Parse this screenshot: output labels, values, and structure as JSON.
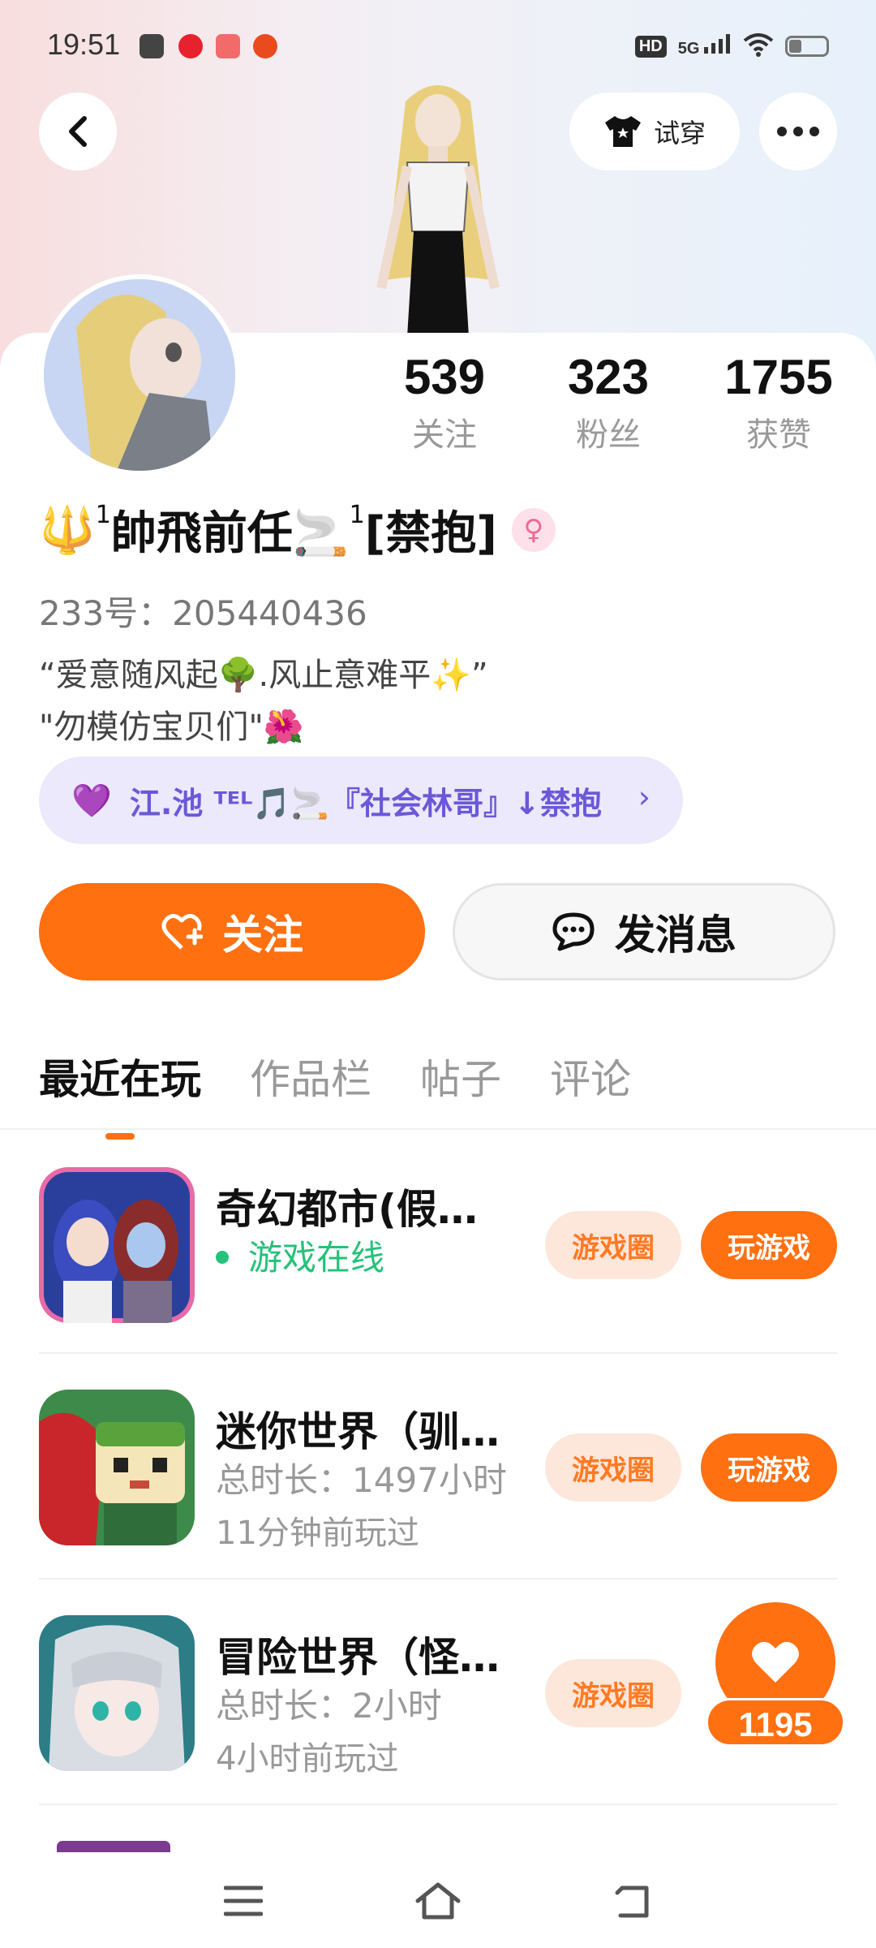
{
  "status_bar": {
    "time": "19:51",
    "hd": "HD",
    "network": "5G",
    "battery_level": 0.35
  },
  "header": {
    "try_on_label": "试穿"
  },
  "stats": [
    {
      "value": "539",
      "label": "关注"
    },
    {
      "value": "323",
      "label": "粉丝"
    },
    {
      "value": "1755",
      "label": "获赞"
    }
  ],
  "profile": {
    "name_prefix": "🔱",
    "sup1": "1",
    "name_main": "帥飛前任🚬",
    "sup2": "1",
    "name_suffix": "[禁抱]",
    "gender_symbol": "♀",
    "uid": "233号：205440436",
    "bio_line1": "“爱意随风起🌳.风止意难平✨”",
    "bio_line2": "\"勿模仿宝贝们\"🌺",
    "group_label": "江.池 ᵀᴱᴸ🎵🚬『社会林哥』↓禁抱"
  },
  "actions": {
    "follow_label": "关注",
    "message_label": "发消息"
  },
  "tabs": [
    "最近在玩",
    "作品栏",
    "帖子",
    "评论"
  ],
  "games": [
    {
      "title": "奇幻都市(假…",
      "line1": "游戏在线",
      "line2": "",
      "circle_label": "游戏圈",
      "play_label": "玩游戏"
    },
    {
      "title": "迷你世界（驯…",
      "line1": "总时长：1497小时",
      "line2": "11分钟前玩过",
      "circle_label": "游戏圈",
      "play_label": "玩游戏"
    },
    {
      "title": "冒险世界（怪…",
      "line1": "总时长：2小时",
      "line2": "4小时前玩过",
      "circle_label": "游戏圈",
      "play_label": ""
    }
  ],
  "like_count": "1195",
  "colors": {
    "accent": "#ff7011",
    "group_text": "#6b58d8",
    "online": "#24c27a"
  }
}
